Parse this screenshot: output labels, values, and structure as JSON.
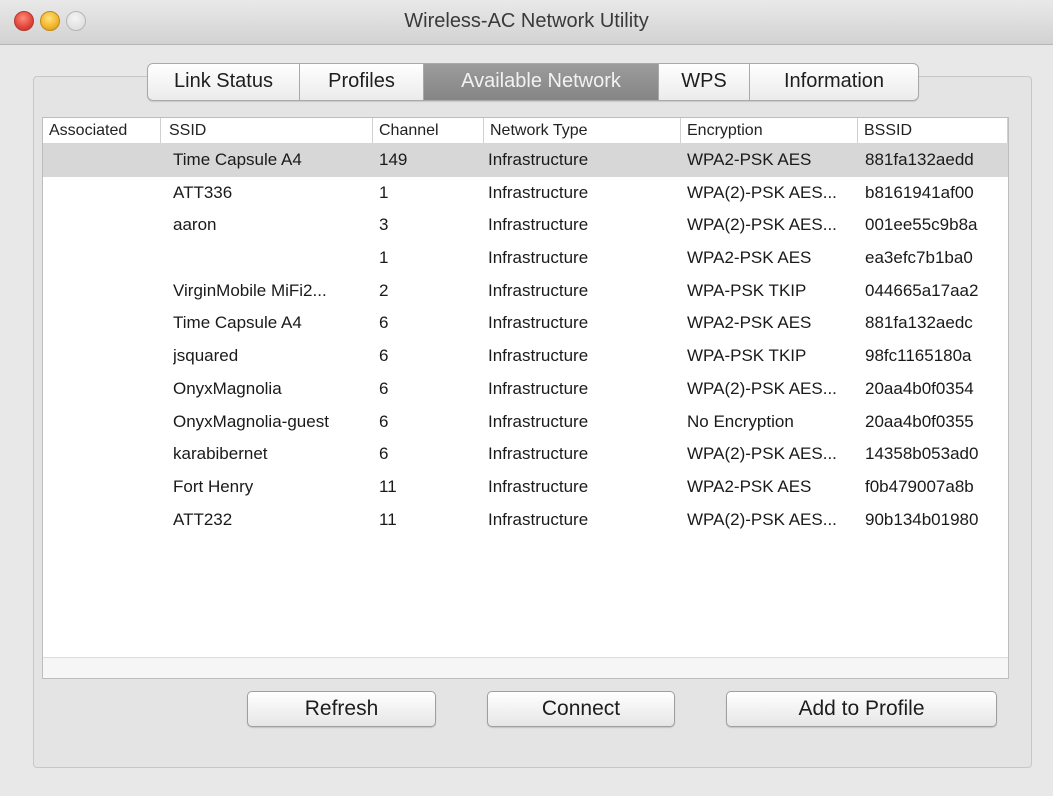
{
  "window": {
    "title": "Wireless-AC Network Utility"
  },
  "tabs": [
    {
      "label": "Link Status",
      "active": false
    },
    {
      "label": "Profiles",
      "active": false
    },
    {
      "label": "Available Network",
      "active": true
    },
    {
      "label": "WPS",
      "active": false
    },
    {
      "label": "Information",
      "active": false
    }
  ],
  "table": {
    "headers": {
      "associated": "Associated",
      "ssid": "SSID",
      "channel": "Channel",
      "network_type": "Network Type",
      "encryption": "Encryption",
      "bssid": "BSSID"
    },
    "rows": [
      {
        "associated": "",
        "ssid": "Time Capsule A4",
        "channel": "149",
        "network_type": "Infrastructure",
        "encryption": "WPA2-PSK AES",
        "bssid": "881fa132aedd",
        "selected": true
      },
      {
        "associated": "",
        "ssid": "ATT336",
        "channel": "1",
        "network_type": "Infrastructure",
        "encryption": "WPA(2)-PSK AES...",
        "bssid": "b8161941af00",
        "selected": false
      },
      {
        "associated": "",
        "ssid": "aaron",
        "channel": "3",
        "network_type": "Infrastructure",
        "encryption": "WPA(2)-PSK AES...",
        "bssid": "001ee55c9b8a",
        "selected": false
      },
      {
        "associated": "",
        "ssid": "",
        "channel": "1",
        "network_type": "Infrastructure",
        "encryption": "WPA2-PSK AES",
        "bssid": "ea3efc7b1ba0",
        "selected": false
      },
      {
        "associated": "",
        "ssid": "VirginMobile MiFi2...",
        "channel": "2",
        "network_type": "Infrastructure",
        "encryption": "WPA-PSK TKIP",
        "bssid": "044665a17aa2",
        "selected": false
      },
      {
        "associated": "",
        "ssid": "Time Capsule A4",
        "channel": "6",
        "network_type": "Infrastructure",
        "encryption": "WPA2-PSK AES",
        "bssid": "881fa132aedc",
        "selected": false
      },
      {
        "associated": "",
        "ssid": "jsquared",
        "channel": "6",
        "network_type": "Infrastructure",
        "encryption": "WPA-PSK TKIP",
        "bssid": "98fc1165180a",
        "selected": false
      },
      {
        "associated": "",
        "ssid": "OnyxMagnolia",
        "channel": "6",
        "network_type": "Infrastructure",
        "encryption": "WPA(2)-PSK AES...",
        "bssid": "20aa4b0f0354",
        "selected": false
      },
      {
        "associated": "",
        "ssid": "OnyxMagnolia-guest",
        "channel": "6",
        "network_type": "Infrastructure",
        "encryption": "No Encryption",
        "bssid": "20aa4b0f0355",
        "selected": false
      },
      {
        "associated": "",
        "ssid": "karabibernet",
        "channel": "6",
        "network_type": "Infrastructure",
        "encryption": "WPA(2)-PSK AES...",
        "bssid": "14358b053ad0",
        "selected": false
      },
      {
        "associated": "",
        "ssid": "Fort Henry",
        "channel": "11",
        "network_type": "Infrastructure",
        "encryption": "WPA2-PSK AES",
        "bssid": "f0b479007a8b",
        "selected": false
      },
      {
        "associated": "",
        "ssid": "ATT232",
        "channel": "11",
        "network_type": "Infrastructure",
        "encryption": "WPA(2)-PSK AES...",
        "bssid": "90b134b01980",
        "selected": false
      }
    ]
  },
  "buttons": {
    "refresh": "Refresh",
    "connect": "Connect",
    "add_to_profile": "Add to Profile"
  }
}
